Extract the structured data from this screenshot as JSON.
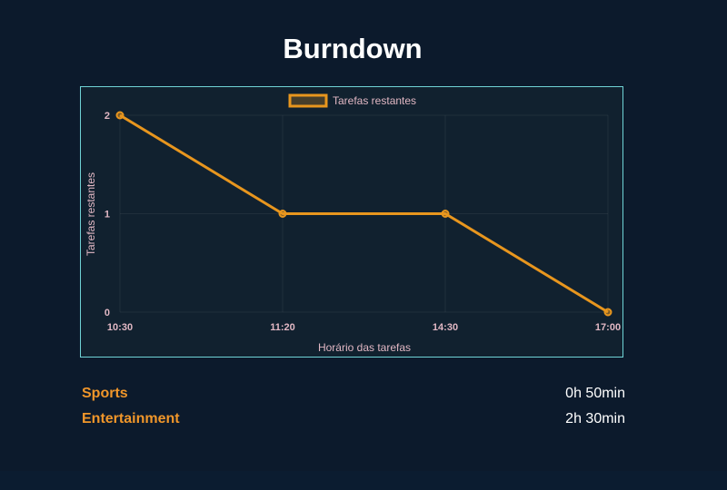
{
  "page": {
    "title": "Burndown"
  },
  "colors": {
    "background": "#0c1a2c",
    "panel": "#11212f",
    "panel_border": "#6fd3d6",
    "series": "#e8961e",
    "axis_text": "#e2b8c4",
    "category_label": "#f0962a",
    "value_text": "#ffffff"
  },
  "chart_data": {
    "type": "line",
    "x": [
      "10:30",
      "11:20",
      "14:30",
      "17:00"
    ],
    "series": [
      {
        "name": "Tarefas restantes",
        "values": [
          2,
          1,
          1,
          0
        ]
      }
    ],
    "xlabel": "Horário das tarefas",
    "ylabel": "Tarefas restantes",
    "ylim": [
      0,
      2
    ],
    "yticks": [
      0,
      1,
      2
    ],
    "grid": true,
    "legend": "top-center"
  },
  "summary": {
    "items": [
      {
        "label": "Sports",
        "value": "0h 50min"
      },
      {
        "label": "Entertainment",
        "value": "2h 30min"
      }
    ]
  }
}
